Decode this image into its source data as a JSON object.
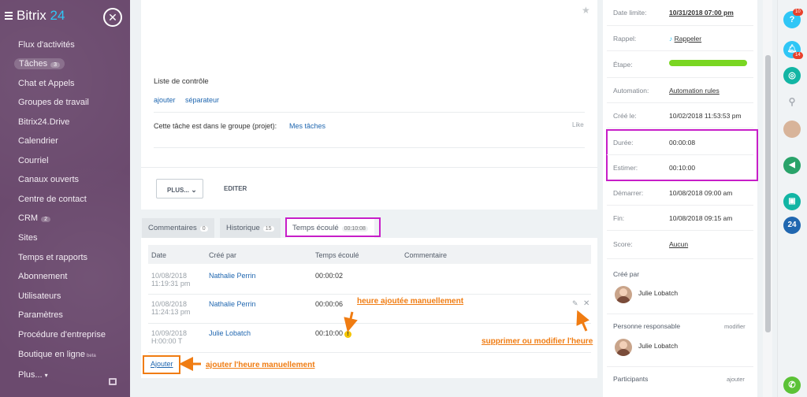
{
  "sidebar": {
    "logo_text": "Bitrix",
    "logo_num": "24",
    "items": [
      {
        "label": "Flux d'activités"
      },
      {
        "label": "Tâches",
        "badge": "3"
      },
      {
        "label": "Chat et Appels"
      },
      {
        "label": "Groupes de travail"
      },
      {
        "label": "Bitrix24.Drive"
      },
      {
        "label": "Calendrier"
      },
      {
        "label": "Courriel"
      },
      {
        "label": "Canaux ouverts"
      },
      {
        "label": "Centre de contact"
      },
      {
        "label": "CRM",
        "badge": "2"
      },
      {
        "label": "Sites"
      },
      {
        "label": "Temps et rapports"
      },
      {
        "label": "Abonnement"
      },
      {
        "label": "Utilisateurs"
      },
      {
        "label": "Paramètres"
      },
      {
        "label": "Procédure d'entreprise"
      },
      {
        "label": "Boutique en ligne",
        "badge": "beta"
      },
      {
        "label": "Plus..."
      }
    ]
  },
  "task": {
    "checklist_title": "Liste de contrôle",
    "add_link": "ajouter",
    "separator_link": "séparateur",
    "group_text": "Cette tâche est dans le groupe (projet):",
    "group_link": "Mes tâches",
    "like": "Like",
    "plus_button": "PLUS...",
    "edit_button": "EDITER"
  },
  "tabs": [
    {
      "label": "Commentaires",
      "count": "0"
    },
    {
      "label": "Historique",
      "count": "15"
    },
    {
      "label": "Temps écoulé",
      "count": "00:10:08"
    }
  ],
  "time_table": {
    "headers": [
      "Date",
      "Créé par",
      "Temps écoulé",
      "Commentaire"
    ],
    "rows": [
      {
        "date": "10/08/2018",
        "time": "11:19:31 pm",
        "user": "Nathalie Perrin",
        "elapsed": "00:00:02"
      },
      {
        "date": "10/08/2018",
        "time": "11:24:13 pm",
        "user": "Nathalie Perrin",
        "elapsed": "00:00:06"
      },
      {
        "date": "10/09/2018",
        "time": "H:00:00 T",
        "user": "Julie Lobatch",
        "elapsed": "00:10:00"
      }
    ],
    "add_link": "Ajouter"
  },
  "annotations": {
    "manual_time": "heure ajoutée manuellement",
    "delete_edit": "supprimer ou modifier l'heure",
    "add_manual": "ajouter l'heure manuellement",
    "color": "#f07c12",
    "highlight_color": "#c71ec8"
  },
  "details": {
    "deadline_label": "Date limite:",
    "deadline_value": "10/31/2018 07:00 pm",
    "reminder_label": "Rappel:",
    "reminder_value": "Rappeler",
    "stage_label": "Étape:",
    "stage_color": "#7ad622",
    "automation_label": "Automation:",
    "automation_value": "Automation rules",
    "created_label": "Créé le:",
    "created_value": "10/02/2018 11:53:53 pm",
    "duration_label": "Durée:",
    "duration_value": "00:00:08",
    "estimate_label": "Estimer:",
    "estimate_value": "00:10:00",
    "start_label": "Démarrer:",
    "start_value": "10/08/2018 09:00 am",
    "end_label": "Fin:",
    "end_value": "10/08/2018 09:15 am",
    "score_label": "Score:",
    "score_value": "Aucun",
    "created_by_label": "Créé par",
    "created_by_name": "Julie Lobatch",
    "responsible_label": "Personne responsable",
    "responsible_modify": "modifier",
    "responsible_name": "Julie Lobatch",
    "participants_label": "Participants",
    "participants_add": "ajouter"
  },
  "toolbar": {
    "help_badge": "10",
    "notif_badge": "14",
    "b24": "24"
  }
}
